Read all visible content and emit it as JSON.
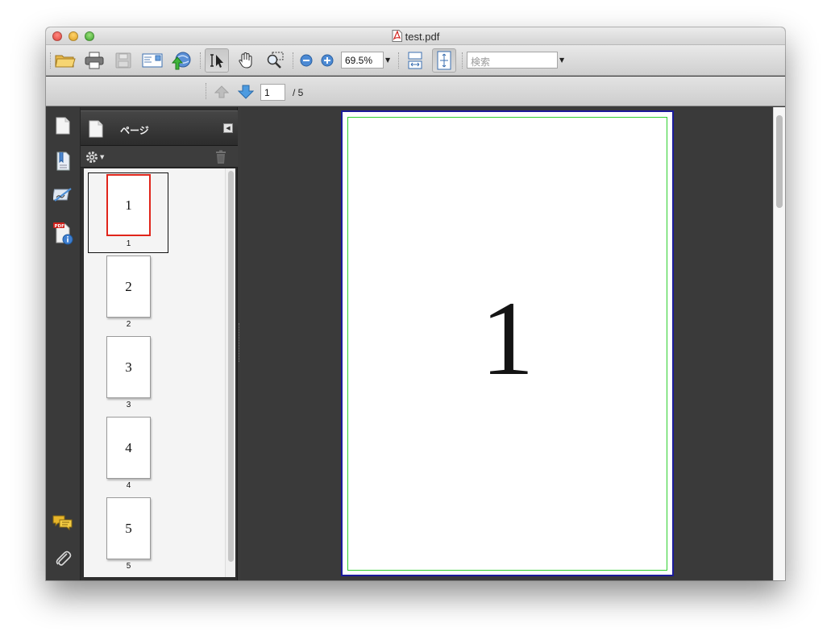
{
  "window": {
    "title": "test.pdf"
  },
  "toolbar": {
    "zoom_value": "69.5%",
    "search_placeholder": "検索"
  },
  "navigation": {
    "current_page": "1",
    "total_pages": "/  5"
  },
  "panel": {
    "title": "ページ"
  },
  "thumbnails": [
    {
      "label": "1",
      "number": "1"
    },
    {
      "label": "2",
      "number": "2"
    },
    {
      "label": "3",
      "number": "3"
    },
    {
      "label": "4",
      "number": "4"
    },
    {
      "label": "5",
      "number": "5"
    }
  ],
  "document": {
    "page_text": "1"
  },
  "colors": {
    "selected_thumbnail_border": "#e0251b",
    "page_border": "#1b1b9a",
    "page_inner_border": "#2fd12f"
  }
}
